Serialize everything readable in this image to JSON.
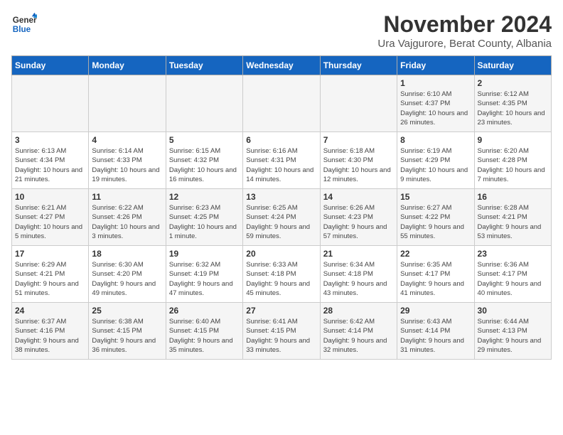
{
  "logo": {
    "text_general": "General",
    "text_blue": "Blue"
  },
  "header": {
    "title": "November 2024",
    "subtitle": "Ura Vajgurore, Berat County, Albania"
  },
  "days_of_week": [
    "Sunday",
    "Monday",
    "Tuesday",
    "Wednesday",
    "Thursday",
    "Friday",
    "Saturday"
  ],
  "weeks": [
    [
      {
        "day": "",
        "detail": ""
      },
      {
        "day": "",
        "detail": ""
      },
      {
        "day": "",
        "detail": ""
      },
      {
        "day": "",
        "detail": ""
      },
      {
        "day": "",
        "detail": ""
      },
      {
        "day": "1",
        "detail": "Sunrise: 6:10 AM\nSunset: 4:37 PM\nDaylight: 10 hours and 26 minutes."
      },
      {
        "day": "2",
        "detail": "Sunrise: 6:12 AM\nSunset: 4:35 PM\nDaylight: 10 hours and 23 minutes."
      }
    ],
    [
      {
        "day": "3",
        "detail": "Sunrise: 6:13 AM\nSunset: 4:34 PM\nDaylight: 10 hours and 21 minutes."
      },
      {
        "day": "4",
        "detail": "Sunrise: 6:14 AM\nSunset: 4:33 PM\nDaylight: 10 hours and 19 minutes."
      },
      {
        "day": "5",
        "detail": "Sunrise: 6:15 AM\nSunset: 4:32 PM\nDaylight: 10 hours and 16 minutes."
      },
      {
        "day": "6",
        "detail": "Sunrise: 6:16 AM\nSunset: 4:31 PM\nDaylight: 10 hours and 14 minutes."
      },
      {
        "day": "7",
        "detail": "Sunrise: 6:18 AM\nSunset: 4:30 PM\nDaylight: 10 hours and 12 minutes."
      },
      {
        "day": "8",
        "detail": "Sunrise: 6:19 AM\nSunset: 4:29 PM\nDaylight: 10 hours and 9 minutes."
      },
      {
        "day": "9",
        "detail": "Sunrise: 6:20 AM\nSunset: 4:28 PM\nDaylight: 10 hours and 7 minutes."
      }
    ],
    [
      {
        "day": "10",
        "detail": "Sunrise: 6:21 AM\nSunset: 4:27 PM\nDaylight: 10 hours and 5 minutes."
      },
      {
        "day": "11",
        "detail": "Sunrise: 6:22 AM\nSunset: 4:26 PM\nDaylight: 10 hours and 3 minutes."
      },
      {
        "day": "12",
        "detail": "Sunrise: 6:23 AM\nSunset: 4:25 PM\nDaylight: 10 hours and 1 minute."
      },
      {
        "day": "13",
        "detail": "Sunrise: 6:25 AM\nSunset: 4:24 PM\nDaylight: 9 hours and 59 minutes."
      },
      {
        "day": "14",
        "detail": "Sunrise: 6:26 AM\nSunset: 4:23 PM\nDaylight: 9 hours and 57 minutes."
      },
      {
        "day": "15",
        "detail": "Sunrise: 6:27 AM\nSunset: 4:22 PM\nDaylight: 9 hours and 55 minutes."
      },
      {
        "day": "16",
        "detail": "Sunrise: 6:28 AM\nSunset: 4:21 PM\nDaylight: 9 hours and 53 minutes."
      }
    ],
    [
      {
        "day": "17",
        "detail": "Sunrise: 6:29 AM\nSunset: 4:21 PM\nDaylight: 9 hours and 51 minutes."
      },
      {
        "day": "18",
        "detail": "Sunrise: 6:30 AM\nSunset: 4:20 PM\nDaylight: 9 hours and 49 minutes."
      },
      {
        "day": "19",
        "detail": "Sunrise: 6:32 AM\nSunset: 4:19 PM\nDaylight: 9 hours and 47 minutes."
      },
      {
        "day": "20",
        "detail": "Sunrise: 6:33 AM\nSunset: 4:18 PM\nDaylight: 9 hours and 45 minutes."
      },
      {
        "day": "21",
        "detail": "Sunrise: 6:34 AM\nSunset: 4:18 PM\nDaylight: 9 hours and 43 minutes."
      },
      {
        "day": "22",
        "detail": "Sunrise: 6:35 AM\nSunset: 4:17 PM\nDaylight: 9 hours and 41 minutes."
      },
      {
        "day": "23",
        "detail": "Sunrise: 6:36 AM\nSunset: 4:17 PM\nDaylight: 9 hours and 40 minutes."
      }
    ],
    [
      {
        "day": "24",
        "detail": "Sunrise: 6:37 AM\nSunset: 4:16 PM\nDaylight: 9 hours and 38 minutes."
      },
      {
        "day": "25",
        "detail": "Sunrise: 6:38 AM\nSunset: 4:15 PM\nDaylight: 9 hours and 36 minutes."
      },
      {
        "day": "26",
        "detail": "Sunrise: 6:40 AM\nSunset: 4:15 PM\nDaylight: 9 hours and 35 minutes."
      },
      {
        "day": "27",
        "detail": "Sunrise: 6:41 AM\nSunset: 4:15 PM\nDaylight: 9 hours and 33 minutes."
      },
      {
        "day": "28",
        "detail": "Sunrise: 6:42 AM\nSunset: 4:14 PM\nDaylight: 9 hours and 32 minutes."
      },
      {
        "day": "29",
        "detail": "Sunrise: 6:43 AM\nSunset: 4:14 PM\nDaylight: 9 hours and 31 minutes."
      },
      {
        "day": "30",
        "detail": "Sunrise: 6:44 AM\nSunset: 4:13 PM\nDaylight: 9 hours and 29 minutes."
      }
    ]
  ]
}
